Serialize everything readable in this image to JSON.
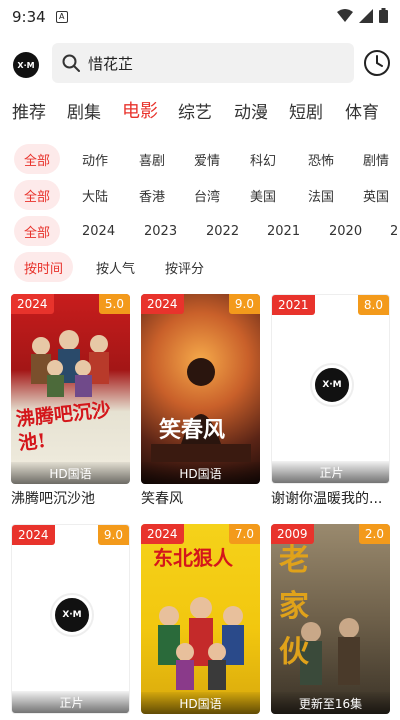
{
  "status": {
    "time": "9:34",
    "notification_letter": "A"
  },
  "logo": {
    "text": "X·M"
  },
  "search": {
    "query": "惜花芷"
  },
  "tabs": [
    "推荐",
    "剧集",
    "电影",
    "综艺",
    "动漫",
    "短剧",
    "体育"
  ],
  "active_tab": "电影",
  "filters": {
    "genre": [
      "全部",
      "动作",
      "喜剧",
      "爱情",
      "科幻",
      "恐怖",
      "剧情"
    ],
    "region": [
      "全部",
      "大陆",
      "香港",
      "台湾",
      "美国",
      "法国",
      "英国"
    ],
    "year": [
      "全部",
      "2024",
      "2023",
      "2022",
      "2021",
      "2020",
      "2"
    ],
    "sort": [
      "按时间",
      "按人气",
      "按评分"
    ]
  },
  "movies": [
    {
      "title": "沸腾吧沉沙池",
      "year": "2024",
      "score": "5.0",
      "quality": "HD国语",
      "poster_text": "沸腾吧沉沙池!"
    },
    {
      "title": "笑春风",
      "year": "2024",
      "score": "9.0",
      "quality": "HD国语",
      "poster_text": "笑春风"
    },
    {
      "title": "谢谢你温暖我的...",
      "year": "2021",
      "score": "8.0",
      "quality": "正片",
      "poster_text": ""
    },
    {
      "title": "",
      "year": "2024",
      "score": "9.0",
      "quality": "正片",
      "poster_text": ""
    },
    {
      "title": "",
      "year": "2024",
      "score": "7.0",
      "quality": "HD国语",
      "poster_text": "东北狠人"
    },
    {
      "title": "",
      "year": "2009",
      "score": "2.0",
      "quality": "更新至16集",
      "poster_text": "老家伙"
    }
  ],
  "colors": {
    "accent": "#e8332c",
    "score_badge": "#f39a1b",
    "chip_bg": "#fdeaea"
  }
}
